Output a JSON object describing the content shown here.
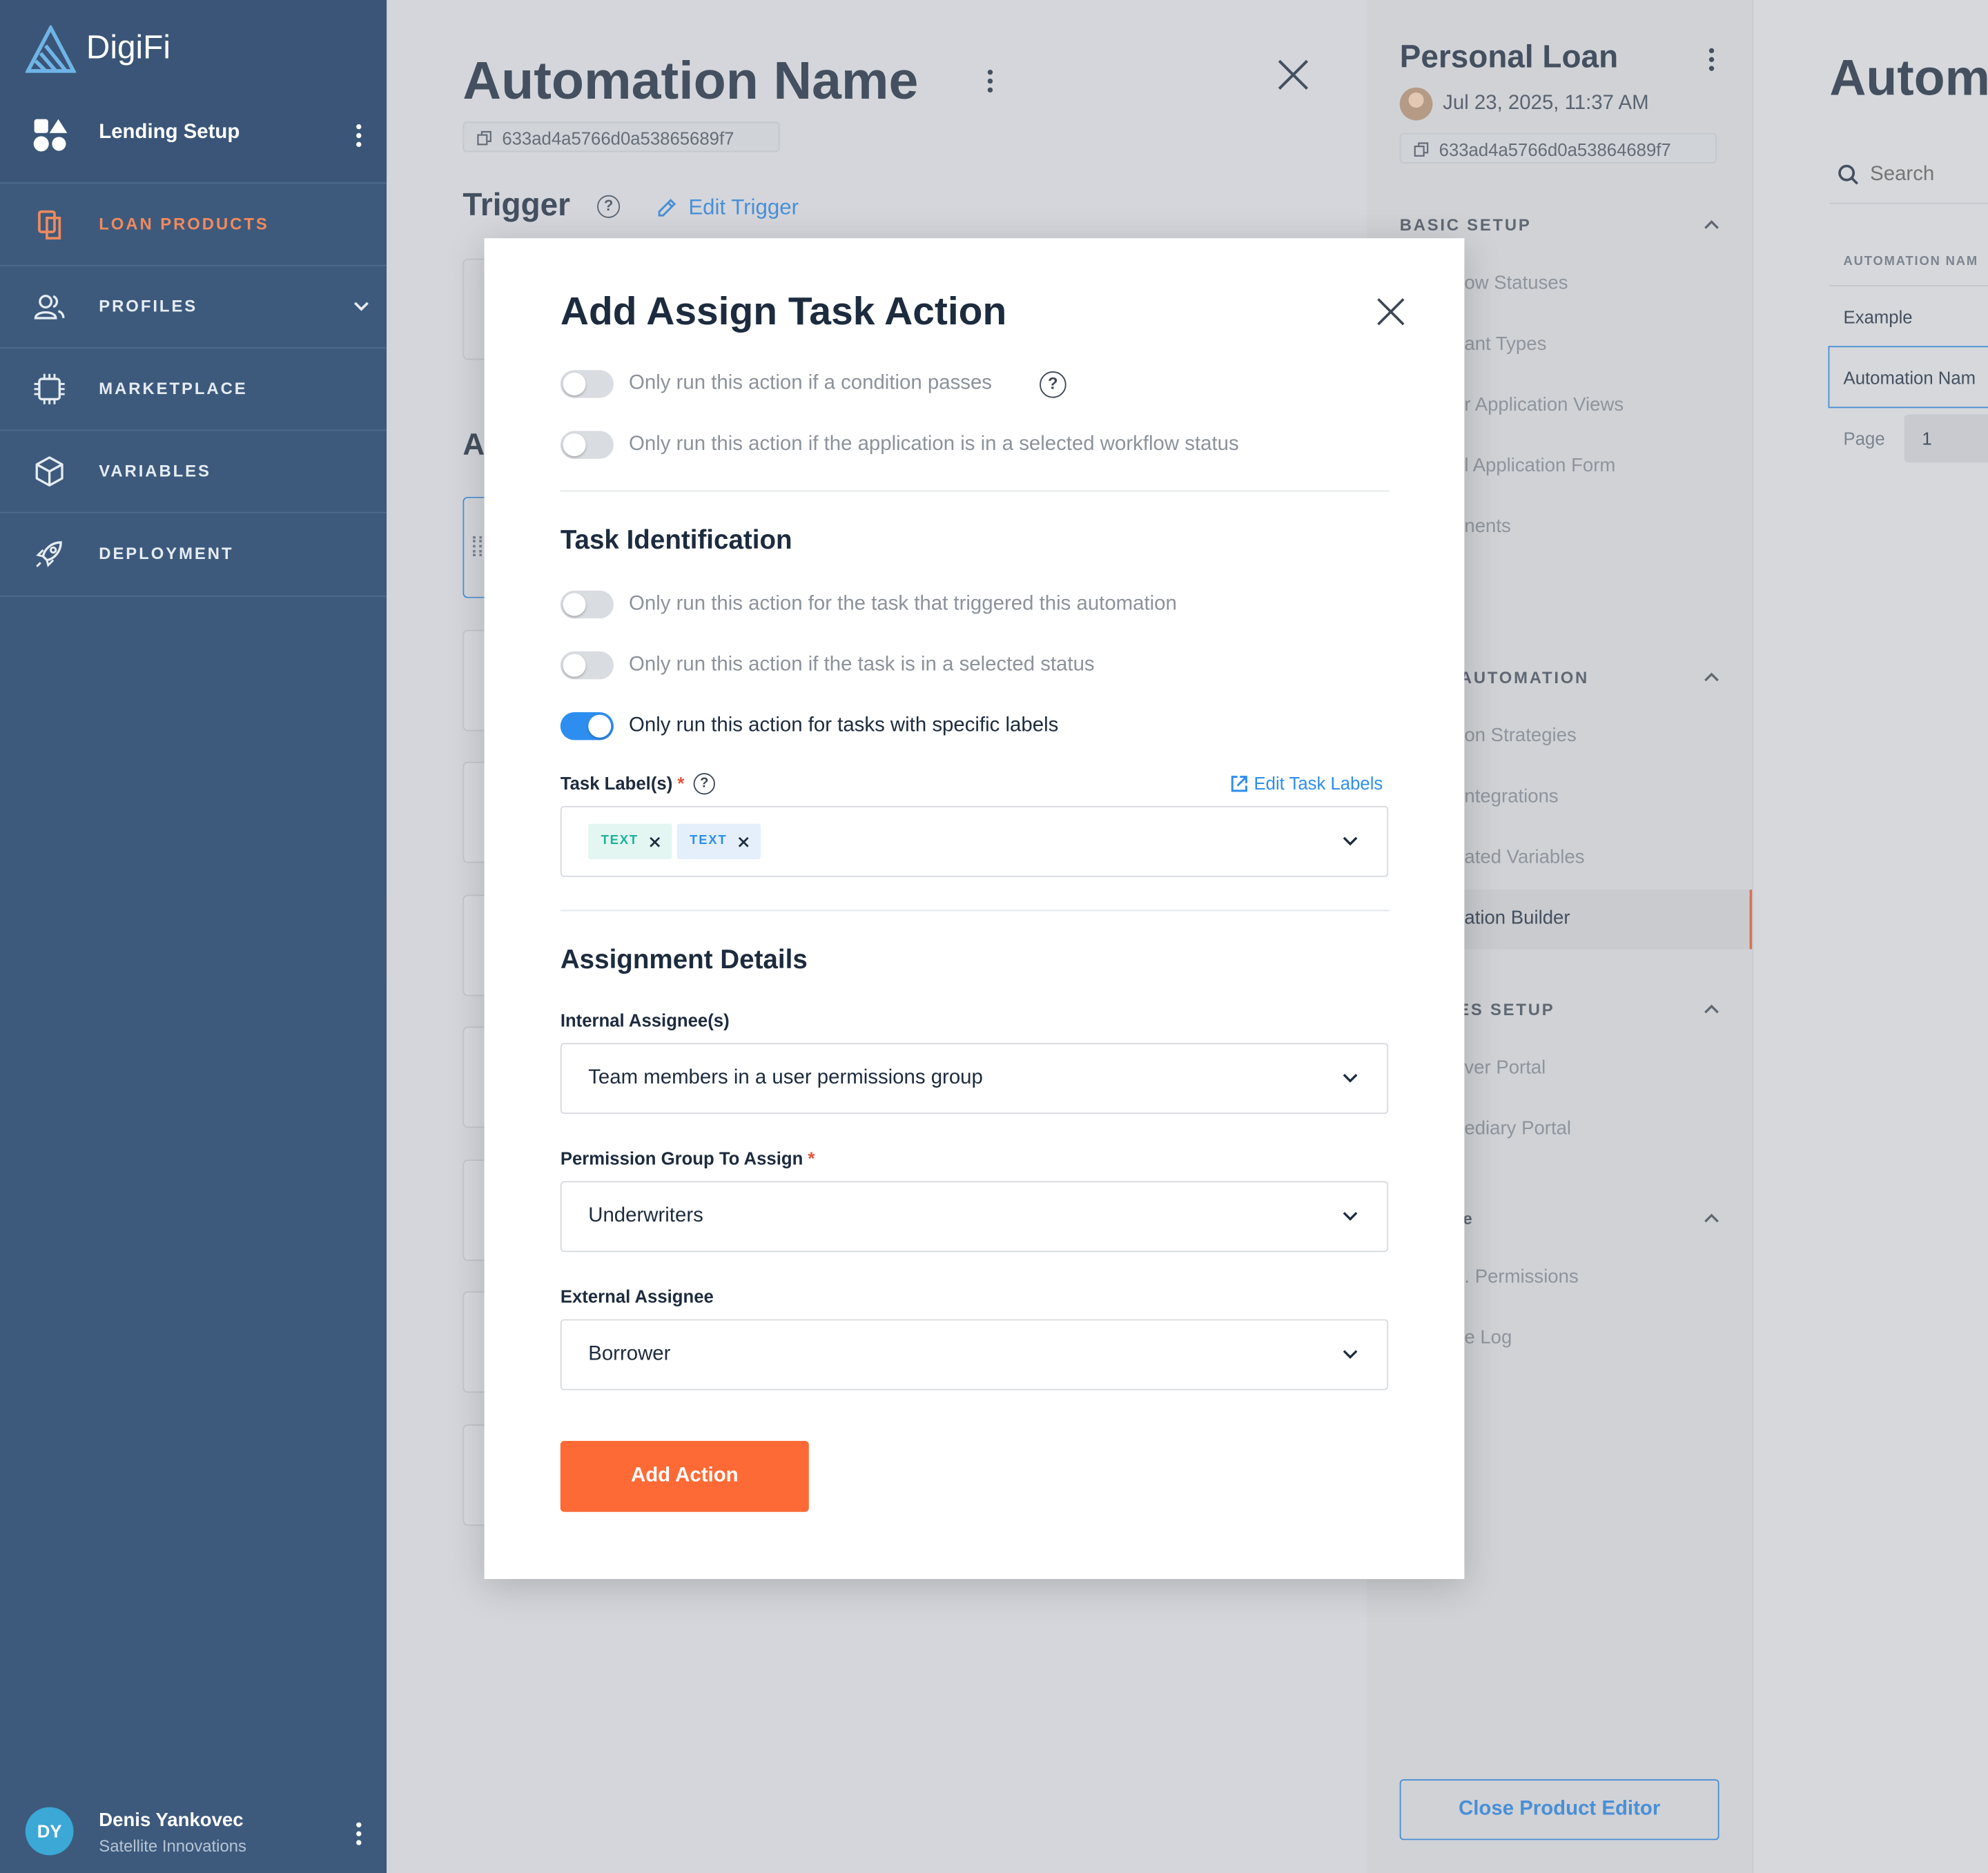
{
  "sidebar": {
    "logo": "DigiFi",
    "workspace": "Lending Setup",
    "nav": [
      {
        "label": "LOAN PRODUCTS",
        "icon": "loan-products-icon",
        "active": true
      },
      {
        "label": "PROFILES",
        "icon": "profiles-icon"
      },
      {
        "label": "MARKETPLACE",
        "icon": "marketplace-icon"
      },
      {
        "label": "VARIABLES",
        "icon": "variables-icon"
      },
      {
        "label": "DEPLOYMENT",
        "icon": "deployment-icon"
      }
    ],
    "user": {
      "initials": "DY",
      "name": "Denis Yankovec",
      "org": "Satellite Innovations"
    }
  },
  "automation": {
    "title": "Automation Name",
    "id": "633ad4a5766d0a53865689f7",
    "trigger_heading": "Trigger",
    "edit_trigger": "Edit Trigger",
    "actions_heading_initial": "A"
  },
  "product": {
    "title": "Personal Loan",
    "date": "Jul 23, 2025, 11:37 AM",
    "id": "633ad4a5766d0a53864689f7",
    "sections": [
      {
        "title": "BASIC SETUP",
        "items": [
          "ow Statuses",
          "ant Types",
          "r Application Views",
          "l Application Form",
          "nents"
        ]
      },
      {
        "title": "NCED AUTOMATION",
        "items": [
          "on Strategies",
          "ntegrations",
          "ated Variables",
          "ation Builder"
        ]
      },
      {
        "title": "L PAGES SETUP",
        "items": [
          "ver Portal",
          "ediary Portal"
        ]
      },
      {
        "title": "e",
        "items": [
          ". Permissions",
          "e Log"
        ]
      }
    ],
    "close_button": "Close Product Editor"
  },
  "list_panel": {
    "title": "Autom",
    "search_placeholder": "Search",
    "column": "AUTOMATION NAM",
    "rows": [
      "Example",
      "Automation Nam"
    ],
    "page_label": "Page",
    "page_value": "1"
  },
  "modal": {
    "title": "Add Assign Task Action",
    "toggles_top": [
      {
        "label": "Only run this action if a condition passes",
        "on": false
      },
      {
        "label": "Only run this action if the application is in a selected workflow status",
        "on": false
      }
    ],
    "task_identification": {
      "title": "Task Identification",
      "toggles": [
        {
          "label": "Only run this action for the task that triggered this automation",
          "on": false
        },
        {
          "label": "Only run this action if the task is in a selected status",
          "on": false
        },
        {
          "label": "Only run this action for tasks with specific labels",
          "on": true
        }
      ],
      "labels_field": "Task Label(s)",
      "edit_labels": "Edit Task Labels",
      "tags": [
        {
          "text": "TEXT",
          "color": "#1bb39a",
          "bg": "#e3f6f2"
        },
        {
          "text": "TEXT",
          "color": "#2d8ef0",
          "bg": "#e4effb"
        }
      ]
    },
    "assignment": {
      "title": "Assignment Details",
      "internal_label": "Internal Assignee(s)",
      "internal_value": "Team members in a user permissions group",
      "group_label": "Permission Group To Assign",
      "group_value": "Underwriters",
      "external_label": "External Assignee",
      "external_value": "Borrower"
    },
    "submit": "Add Action"
  },
  "colors": {
    "accent": "#fe6a35",
    "link": "#2d8ef0",
    "sidebar": "#3d5a7d",
    "active_nav": "#f08a5d"
  }
}
